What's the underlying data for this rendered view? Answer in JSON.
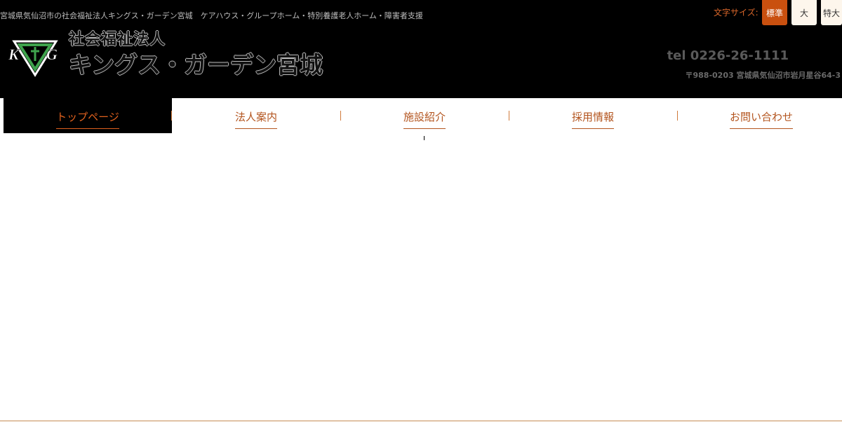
{
  "header": {
    "tagline": "宮城県気仙沼市の社会福祉法人キングス・ガーデン宮城　ケアハウス・グループホーム・特別養護老人ホーム・障害者支援",
    "font_size": {
      "label": "文字サイズ:",
      "options": [
        "標準",
        "大",
        "特大"
      ],
      "selected": "標準"
    },
    "logo": {
      "icon": "kg-triangle-logo",
      "letters": [
        "K",
        "G"
      ]
    },
    "org_type": "社会福祉法人",
    "org_name": "キングス・ガーデン宮城",
    "tel": "tel 0226-26-1111",
    "address": "〒988-0203 宮城県気仙沼市岩月星谷64-3"
  },
  "nav": {
    "items": [
      {
        "label": "トップページ",
        "active": true
      },
      {
        "label": "法人案内",
        "active": false
      },
      {
        "label": "施設紹介",
        "active": false
      },
      {
        "label": "採用情報",
        "active": false
      },
      {
        "label": "お問い合わせ",
        "active": false
      }
    ]
  },
  "colors": {
    "header_bg": "#000000",
    "accent": "#c9500f",
    "nav_text": "#b3541e",
    "logo_green": "#3fa34d"
  }
}
